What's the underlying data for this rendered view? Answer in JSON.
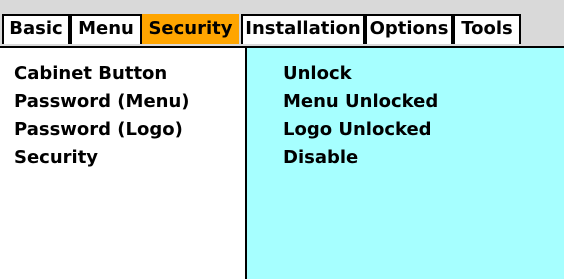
{
  "tabs": [
    {
      "label": "Basic",
      "active": false
    },
    {
      "label": "Menu",
      "active": false
    },
    {
      "label": "Security",
      "active": true
    },
    {
      "label": "Installation",
      "active": false
    },
    {
      "label": "Options",
      "active": false
    },
    {
      "label": "Tools",
      "active": false
    }
  ],
  "settings": [
    {
      "label": "Cabinet Button",
      "value": "Unlock"
    },
    {
      "label": "Password (Menu)",
      "value": "Menu Unlocked"
    },
    {
      "label": "Password (Logo)",
      "value": "Logo Unlocked"
    },
    {
      "label": "Security",
      "value": "Disable"
    }
  ],
  "colors": {
    "active_tab": "#ffa500",
    "value_panel": "#a6ffff",
    "tabbar": "#d9d9d9"
  }
}
